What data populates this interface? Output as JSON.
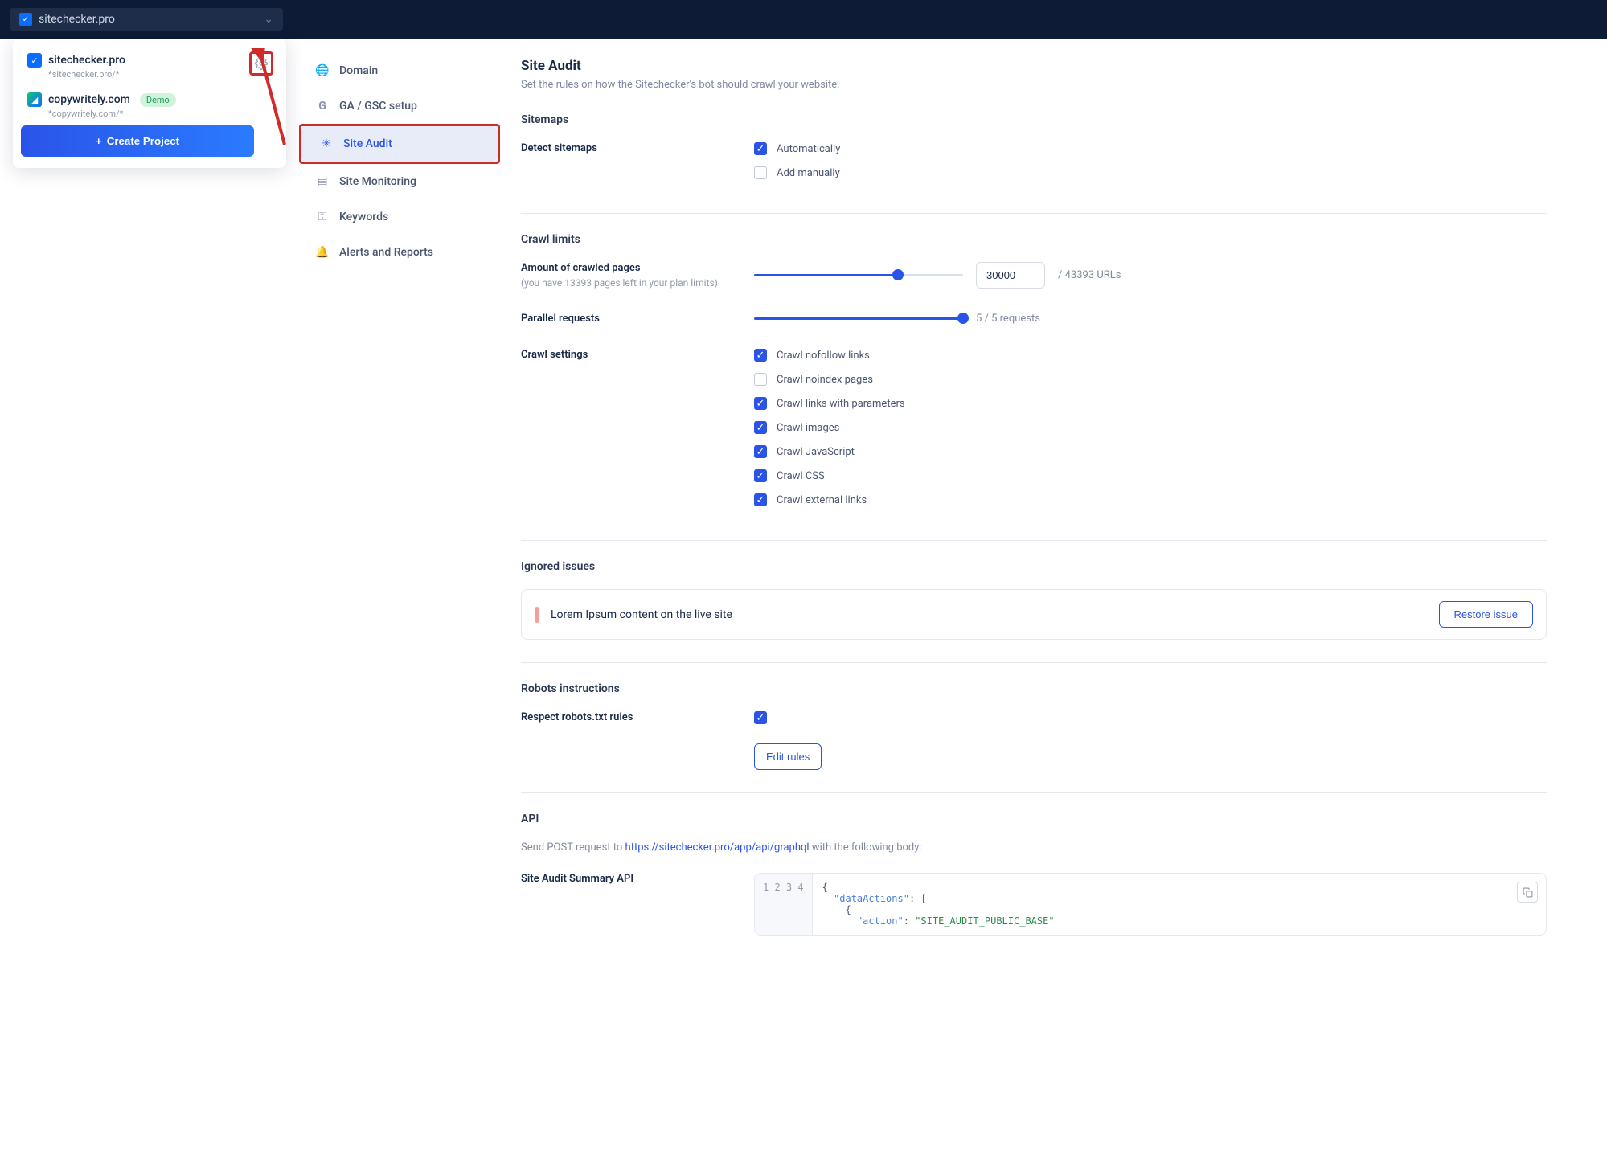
{
  "topbar": {
    "current_site": "sitechecker.pro"
  },
  "projects": {
    "items": [
      {
        "name": "sitechecker.pro",
        "sub": "*sitechecker.pro/*",
        "has_gear": true
      },
      {
        "name": "copywritely.com",
        "sub": "*copywritely.com/*",
        "badge": "Demo"
      }
    ],
    "create_label": "Create Project"
  },
  "nav": [
    {
      "label": "Domain",
      "icon": "globe"
    },
    {
      "label": "GA / GSC setup",
      "icon": "g"
    },
    {
      "label": "Site Audit",
      "icon": "bug",
      "active": true
    },
    {
      "label": "Site Monitoring",
      "icon": "chart"
    },
    {
      "label": "Keywords",
      "icon": "key"
    },
    {
      "label": "Alerts and Reports",
      "icon": "bell"
    }
  ],
  "main": {
    "title": "Site Audit",
    "subtitle": "Set the rules on how the Sitechecker's bot should crawl your website.",
    "sitemaps": {
      "heading": "Sitemaps",
      "detect_label": "Detect sitemaps",
      "opts": [
        {
          "label": "Automatically",
          "checked": true
        },
        {
          "label": "Add manually",
          "checked": false
        }
      ]
    },
    "crawl_limits": {
      "heading": "Crawl limits",
      "amount_label": "Amount of crawled pages",
      "amount_hint": "(you have 13393 pages left in your plan limits)",
      "amount_value": "30000",
      "amount_suffix": "/ 43393 URLs",
      "amount_pct": 69,
      "parallel_label": "Parallel requests",
      "parallel_text": "5 / 5 requests",
      "parallel_pct": 100,
      "settings_label": "Crawl settings",
      "settings": [
        {
          "label": "Crawl nofollow links",
          "checked": true
        },
        {
          "label": "Crawl noindex pages",
          "checked": false
        },
        {
          "label": "Crawl links with parameters",
          "checked": true
        },
        {
          "label": "Crawl images",
          "checked": true
        },
        {
          "label": "Crawl JavaScript",
          "checked": true
        },
        {
          "label": "Crawl CSS",
          "checked": true
        },
        {
          "label": "Crawl external links",
          "checked": true
        }
      ]
    },
    "ignored": {
      "heading": "Ignored issues",
      "issue_text": "Lorem Ipsum content on the live site",
      "restore_label": "Restore issue"
    },
    "robots": {
      "heading": "Robots instructions",
      "respect_label": "Respect robots.txt rules",
      "respect_checked": true,
      "edit_label": "Edit rules"
    },
    "api": {
      "heading": "API",
      "desc_pre": "Send POST request to ",
      "desc_link": "https://sitechecker.pro/app/api/graphql",
      "desc_post": " with the following body:",
      "summary_label": "Site Audit Summary API",
      "code_lines": [
        "{",
        "  \"dataActions\": [",
        "    {",
        "      \"action\": \"SITE_AUDIT_PUBLIC_BASE\""
      ]
    }
  }
}
